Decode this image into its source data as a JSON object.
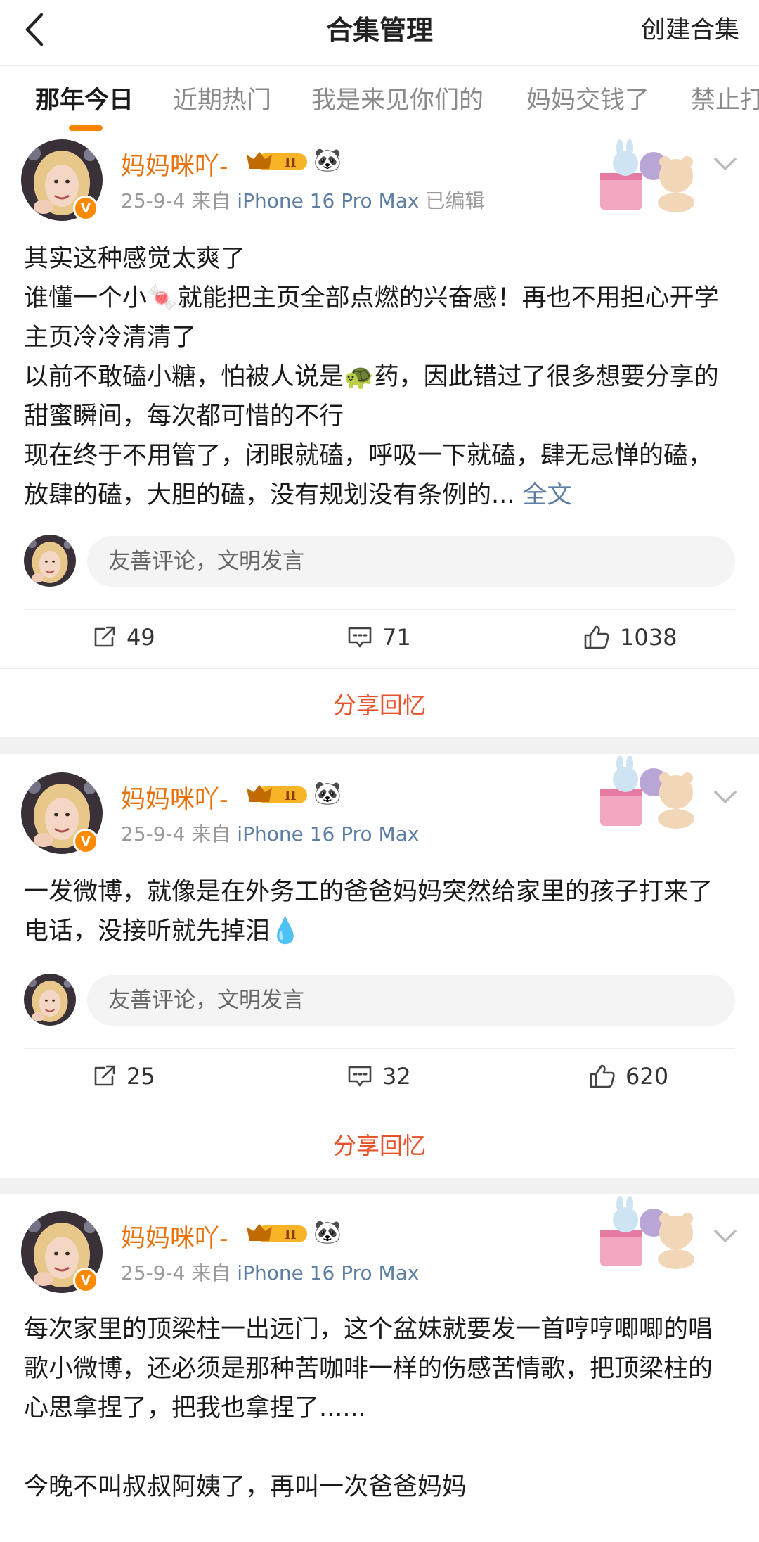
{
  "header": {
    "title": "合集管理",
    "action": "创建合集",
    "back_icon": "chevron-left-icon"
  },
  "tabs": [
    {
      "label": "那年今日",
      "active": true
    },
    {
      "label": "近期热门",
      "active": false
    },
    {
      "label": "我是来见你们的",
      "active": false
    },
    {
      "label": "妈妈交钱了",
      "active": false
    },
    {
      "label": "禁止打",
      "active": false
    }
  ],
  "colors": {
    "accent": "#ff8200",
    "username": "#e8720c",
    "link": "#5d7ea3",
    "share": "#e8522b"
  },
  "posts": [
    {
      "username": "妈妈咪吖-",
      "date": "25-9-4",
      "from": "来自",
      "device": "iPhone 16 Pro Max",
      "edited": "已编辑",
      "lines": [
        "其实这种感觉太爽了",
        "谁懂一个小🍬就能把主页全部点燃的兴奋感！再也不用担心开学主页冷冷清清了",
        "以前不敢磕小糖，怕被人说是🐢药，因此错过了很多想要分享的甜蜜瞬间，每次都可惜的不行",
        "现在终于不用管了，闭眼就磕，呼吸一下就磕，肆无忌惮的磕，放肆的磕，大胆的磕，没有规划没有条例的..."
      ],
      "full_text_link": "全文",
      "comment_placeholder": "友善评论，文明发言",
      "reposts": "49",
      "comments": "71",
      "likes": "1038",
      "share_label": "分享回忆"
    },
    {
      "username": "妈妈咪吖-",
      "date": "25-9-4",
      "from": "来自",
      "device": "iPhone 16 Pro Max",
      "lines": [
        "一发微博，就像是在外务工的爸爸妈妈突然给家里的孩子打来了电话，没接听就先掉泪💧"
      ],
      "comment_placeholder": "友善评论，文明发言",
      "reposts": "25",
      "comments": "32",
      "likes": "620",
      "share_label": "分享回忆"
    },
    {
      "username": "妈妈咪吖-",
      "date": "25-9-4",
      "from": "来自",
      "device": "iPhone 16 Pro Max",
      "lines": [
        "每次家里的顶梁柱一出远门，这个盆妹就要发一首哼哼唧唧的唱歌小微博，还必须是那种苦咖啡一样的伤感苦情歌，把顶梁柱的心思拿捏了，把我也拿捏了......",
        "",
        "今晚不叫叔叔阿姨了，再叫一次爸爸妈妈"
      ]
    }
  ],
  "icons": {
    "repost": "share-out-icon",
    "comment": "comment-icon",
    "like": "thumbs-up-icon",
    "more": "chevron-down-icon",
    "verified": "verified-badge-icon",
    "member": "crown-member-icon",
    "emoji": "panda-icon"
  }
}
